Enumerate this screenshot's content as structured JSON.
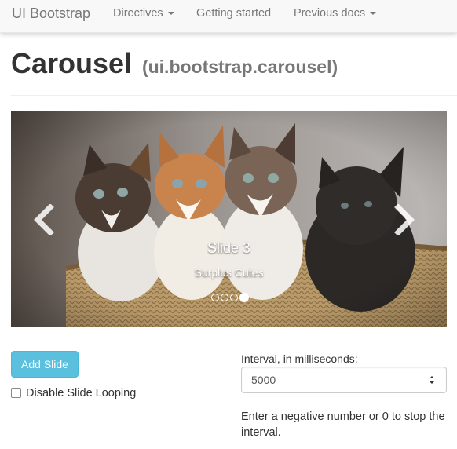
{
  "navbar": {
    "brand": "UI Bootstrap",
    "items": [
      {
        "label": "Directives",
        "has_caret": true
      },
      {
        "label": "Getting started",
        "has_caret": false
      },
      {
        "label": "Previous docs",
        "has_caret": true
      }
    ]
  },
  "page": {
    "title": "Carousel",
    "subtitle": "(ui.bootstrap.carousel)"
  },
  "carousel": {
    "image_subject": "four kittens in a wicker basket",
    "slide_title": "Slide 3",
    "slide_text": "Surplus Cutes",
    "slide_count": 4,
    "active_index": 3,
    "prev_icon": "chevron-left-icon",
    "next_icon": "chevron-right-icon"
  },
  "controls": {
    "add_slide_label": "Add Slide",
    "disable_looping_label": "Disable Slide Looping",
    "disable_looping_checked": false,
    "interval_label": "Interval, in milliseconds:",
    "interval_value": "5000",
    "help_text": "Enter a negative number or 0 to stop the interval."
  },
  "colors": {
    "info_button": "#5bc0de",
    "navbar_bg": "#f8f8f8",
    "muted_text": "#777777"
  }
}
